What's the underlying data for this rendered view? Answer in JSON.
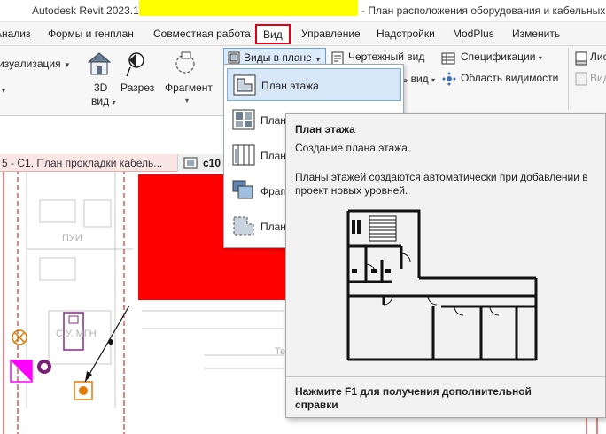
{
  "window": {
    "app_title": "Autodesk Revit 2023.1",
    "doc_title": "- План расположения оборудования и кабельных"
  },
  "tabs": [
    {
      "label": "Анализ"
    },
    {
      "label": "Формы и генплан"
    },
    {
      "label": "Совместная работа"
    },
    {
      "label": "Вид"
    },
    {
      "label": "Управление"
    },
    {
      "label": "Надстройки"
    },
    {
      "label": "ModPlus"
    },
    {
      "label": "Изменить"
    }
  ],
  "ribbon": {
    "visualization": "изуализация",
    "view3d_line1": "3D",
    "view3d_line2": "вид",
    "section": "Разрез",
    "fragment": "Фрагмент",
    "plan_views": "Виды в плане",
    "drafting_view": "Чертежный вид",
    "schedules": "Спецификации",
    "view_suffix": "ь вид",
    "scope_box": "Область видимости",
    "sheet": "Лис",
    "sheet_view": "Вид"
  },
  "view_tab": {
    "label": "5 - С1. План прокладки кабель...",
    "label2": "c10"
  },
  "canvas": {
    "room_label": "ПУИ",
    "room_label2": "С.У. МГН",
    "room_label3": "Те"
  },
  "dropdown": {
    "items": [
      {
        "label": "План этажа"
      },
      {
        "label": "План"
      },
      {
        "label": "План"
      },
      {
        "label": "Фрагм"
      },
      {
        "label": "План"
      }
    ]
  },
  "tooltip": {
    "title": "План этажа",
    "subtitle": "Создание плана этажа.",
    "description": "Планы этажей создаются автоматически при добавлении в проект новых уровней.",
    "help": "Нажмите F1 для получения дополнительной справки"
  },
  "colors": {
    "accent_red": "#e0001a",
    "red_fill": "#ff0000",
    "highlight_yellow": "#ffff00",
    "selection_blue": "#d6e8f8"
  }
}
